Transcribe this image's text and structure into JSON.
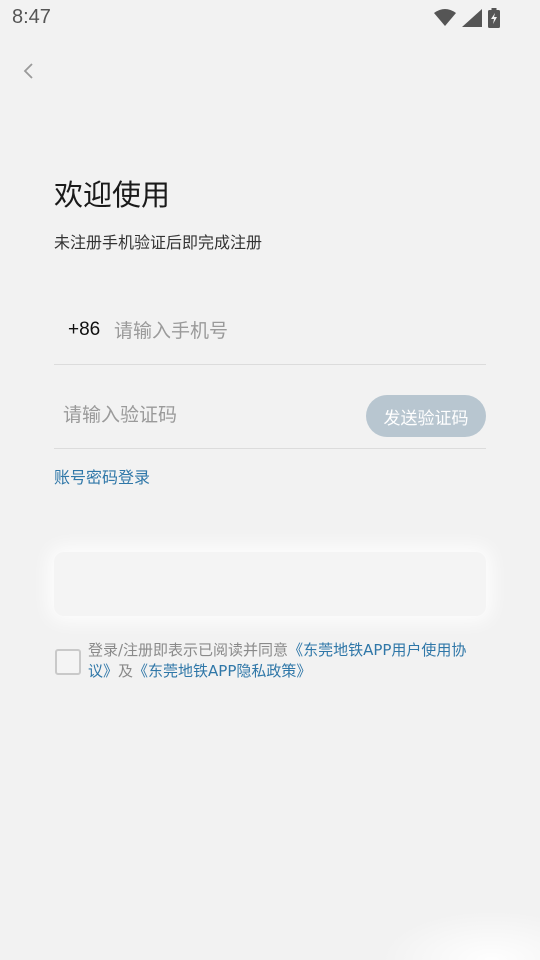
{
  "status_bar": {
    "time": "8:47",
    "icons": [
      "wifi-icon",
      "cellular-signal-icon",
      "battery-charging-icon"
    ]
  },
  "header": {
    "back_icon": "chevron-left-icon"
  },
  "title": "欢迎使用",
  "subtitle": "未注册手机验证后即完成注册",
  "phone": {
    "country_code": "+86",
    "placeholder": "请输入手机号",
    "value": ""
  },
  "code": {
    "placeholder": "请输入验证码",
    "value": "",
    "send_label": "发送验证码"
  },
  "account_login_label": "账号密码登录",
  "agreement": {
    "checked": false,
    "prefix": "登录/注册即表示已阅读并同意",
    "user_agreement": "《东莞地铁APP用户使用协议》",
    "conjunction": "及",
    "privacy_policy": "《东莞地铁APP隐私政策》"
  },
  "colors": {
    "background": "#f2f2f2",
    "link": "#2f77a8",
    "send_button": "#b8c6d0"
  }
}
